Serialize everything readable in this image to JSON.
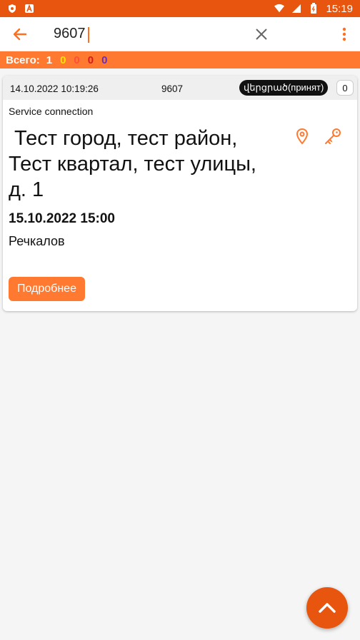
{
  "status_bar": {
    "time": "15:19",
    "icons": [
      "shield-icon",
      "app-a-icon",
      "wifi-icon",
      "signal-icon",
      "battery-icon"
    ]
  },
  "toolbar": {
    "search_value": "9607",
    "icons": [
      "back-arrow-icon",
      "close-icon",
      "more-vert-icon"
    ]
  },
  "summary": {
    "label": "Всего:",
    "counts": [
      {
        "value": "1",
        "color": "#ffffff"
      },
      {
        "value": "0",
        "color": "#ffe000"
      },
      {
        "value": "0",
        "color": "#ff4e3a"
      },
      {
        "value": "0",
        "color": "#d41c1c"
      },
      {
        "value": "0",
        "color": "#6a2fb8"
      }
    ]
  },
  "card": {
    "created": "14.10.2022 10:19:26",
    "number": "9607",
    "status": "վերցրած(принят)",
    "badge_count": "0",
    "service_type": "Service connection",
    "address": {
      "line1": "Тест город, тест район,",
      "line2": "Тест квартал, тест улицы,",
      "line3": "д. 1"
    },
    "due": "15.10.2022 15:00",
    "assignee": "Речкалов",
    "details_label": "Подробнее",
    "icons": [
      "location-pin-icon",
      "key-icon"
    ]
  },
  "fab": {
    "icon": "chevron-up-icon"
  },
  "colors": {
    "accent": "#ff7a30",
    "accent_dark": "#e8550f"
  }
}
